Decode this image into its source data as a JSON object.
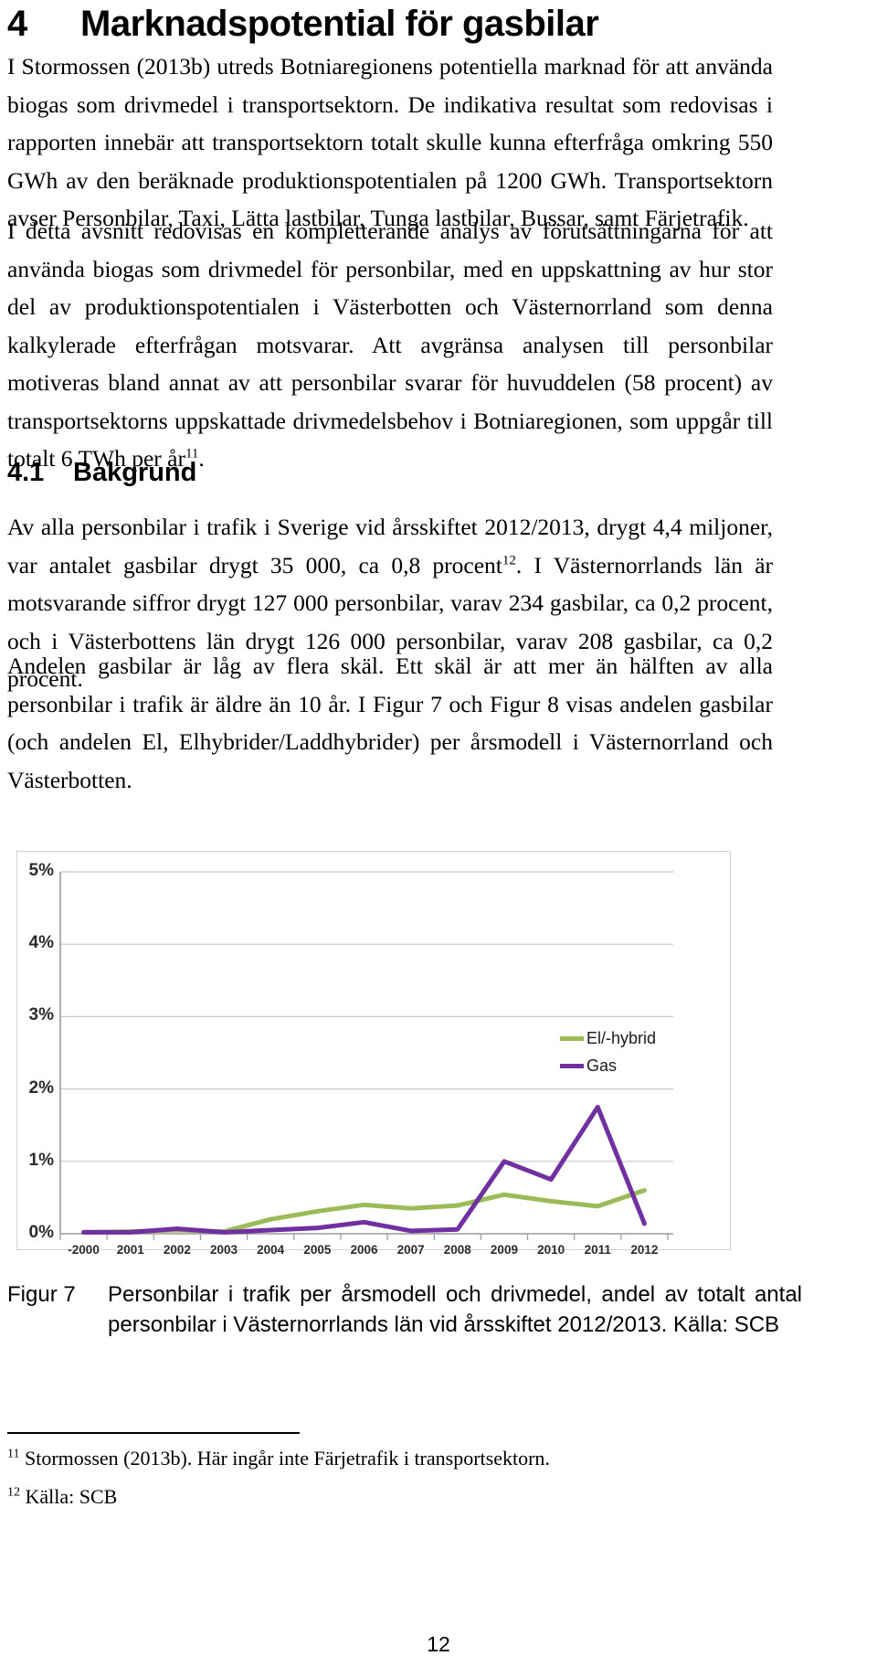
{
  "document": {
    "page_number": "12"
  },
  "headings": {
    "chapter_number": "4",
    "chapter_title": "Marknadspotential för gasbilar",
    "section_number": "4.1",
    "section_title": "Bakgrund"
  },
  "paragraphs": {
    "p1": "I Stormossen (2013b) utreds Botniaregionens potentiella marknad för att använda biogas som drivmedel i transportsektorn. De indikativa resultat som redovisas i rapporten innebär att transportsektorn totalt skulle kunna efterfråga omkring 550 GWh av den beräknade produktionspotentialen på 1200 GWh. Transportsektorn avser Personbilar, Taxi, Lätta lastbilar, Tunga lastbilar, Bussar, samt Färjetrafik.",
    "p2_before_footnote": "I detta avsnitt redovisas en kompletterande analys av förutsättningarna för att använda biogas som drivmedel för personbilar, med en uppskattning av hur stor del av produktionspotentialen i Västerbotten och Västernorrland som denna kalkylerade efterfrågan motsvarar. Att avgränsa analysen till personbilar motiveras bland annat av att personbilar svarar för huvuddelen (58 procent) av transportsektorns uppskattade drivmedelsbehov i Botniaregionen, som uppgår till totalt 6 TWh per år",
    "p2_footnote_marker": "11",
    "p2_after_footnote": ".",
    "p3_a": "Av alla personbilar i trafik i Sverige vid årsskiftet 2012/2013, drygt 4,4 miljoner, var antalet gasbilar drygt 35 000, ca 0,8 procent",
    "p3_footnote_marker": "12",
    "p3_b": ". I Västernorrlands län är motsvarande siffror drygt 127 000 personbilar, varav 234 gasbilar, ca 0,2 procent, och i Västerbottens län drygt 126 000 personbilar, varav 208 gasbilar, ca 0,2 procent.",
    "p4": "Andelen gasbilar är låg av flera skäl. Ett skäl är att mer än hälften av alla personbilar i trafik är äldre än 10 år. I Figur 7 och Figur 8 visas andelen gasbilar (och andelen El, Elhybrider/Laddhybrider) per årsmodell i Västernorrland och Västerbotten."
  },
  "figure": {
    "label": "Figur 7",
    "caption": "Personbilar i trafik per årsmodell och drivmedel, andel av totalt antal personbilar i Västernorrlands län vid årsskiftet 2012/2013. Källa: SCB"
  },
  "footnotes": [
    {
      "marker": "11",
      "text": "Stormossen (2013b). Här ingår inte Färjetrafik i transportsektorn."
    },
    {
      "marker": "12",
      "text": "Källa: SCB"
    }
  ],
  "chart_data": {
    "type": "line",
    "title": "",
    "xlabel": "",
    "ylabel": "",
    "categories": [
      "-2000",
      "2001",
      "2002",
      "2003",
      "2004",
      "2005",
      "2006",
      "2007",
      "2008",
      "2009",
      "2010",
      "2011",
      "2012"
    ],
    "ytick_labels": [
      "5%",
      "4%",
      "3%",
      "2%",
      "1%",
      "0%"
    ],
    "ytick_values": [
      5,
      4,
      3,
      2,
      1,
      0
    ],
    "ylim": [
      0,
      5
    ],
    "grid": true,
    "legend_position": "right",
    "series": [
      {
        "name": "El/-hybrid",
        "color": "#9BBB59",
        "values": [
          0.02,
          0.03,
          0.05,
          0.03,
          0.2,
          0.31,
          0.4,
          0.35,
          0.39,
          0.54,
          0.45,
          0.38,
          0.6
        ]
      },
      {
        "name": "Gas",
        "color": "#7030A0",
        "values": [
          0.02,
          0.02,
          0.07,
          0.02,
          0.05,
          0.08,
          0.16,
          0.04,
          0.06,
          1.0,
          0.75,
          1.75,
          0.14
        ]
      }
    ]
  }
}
